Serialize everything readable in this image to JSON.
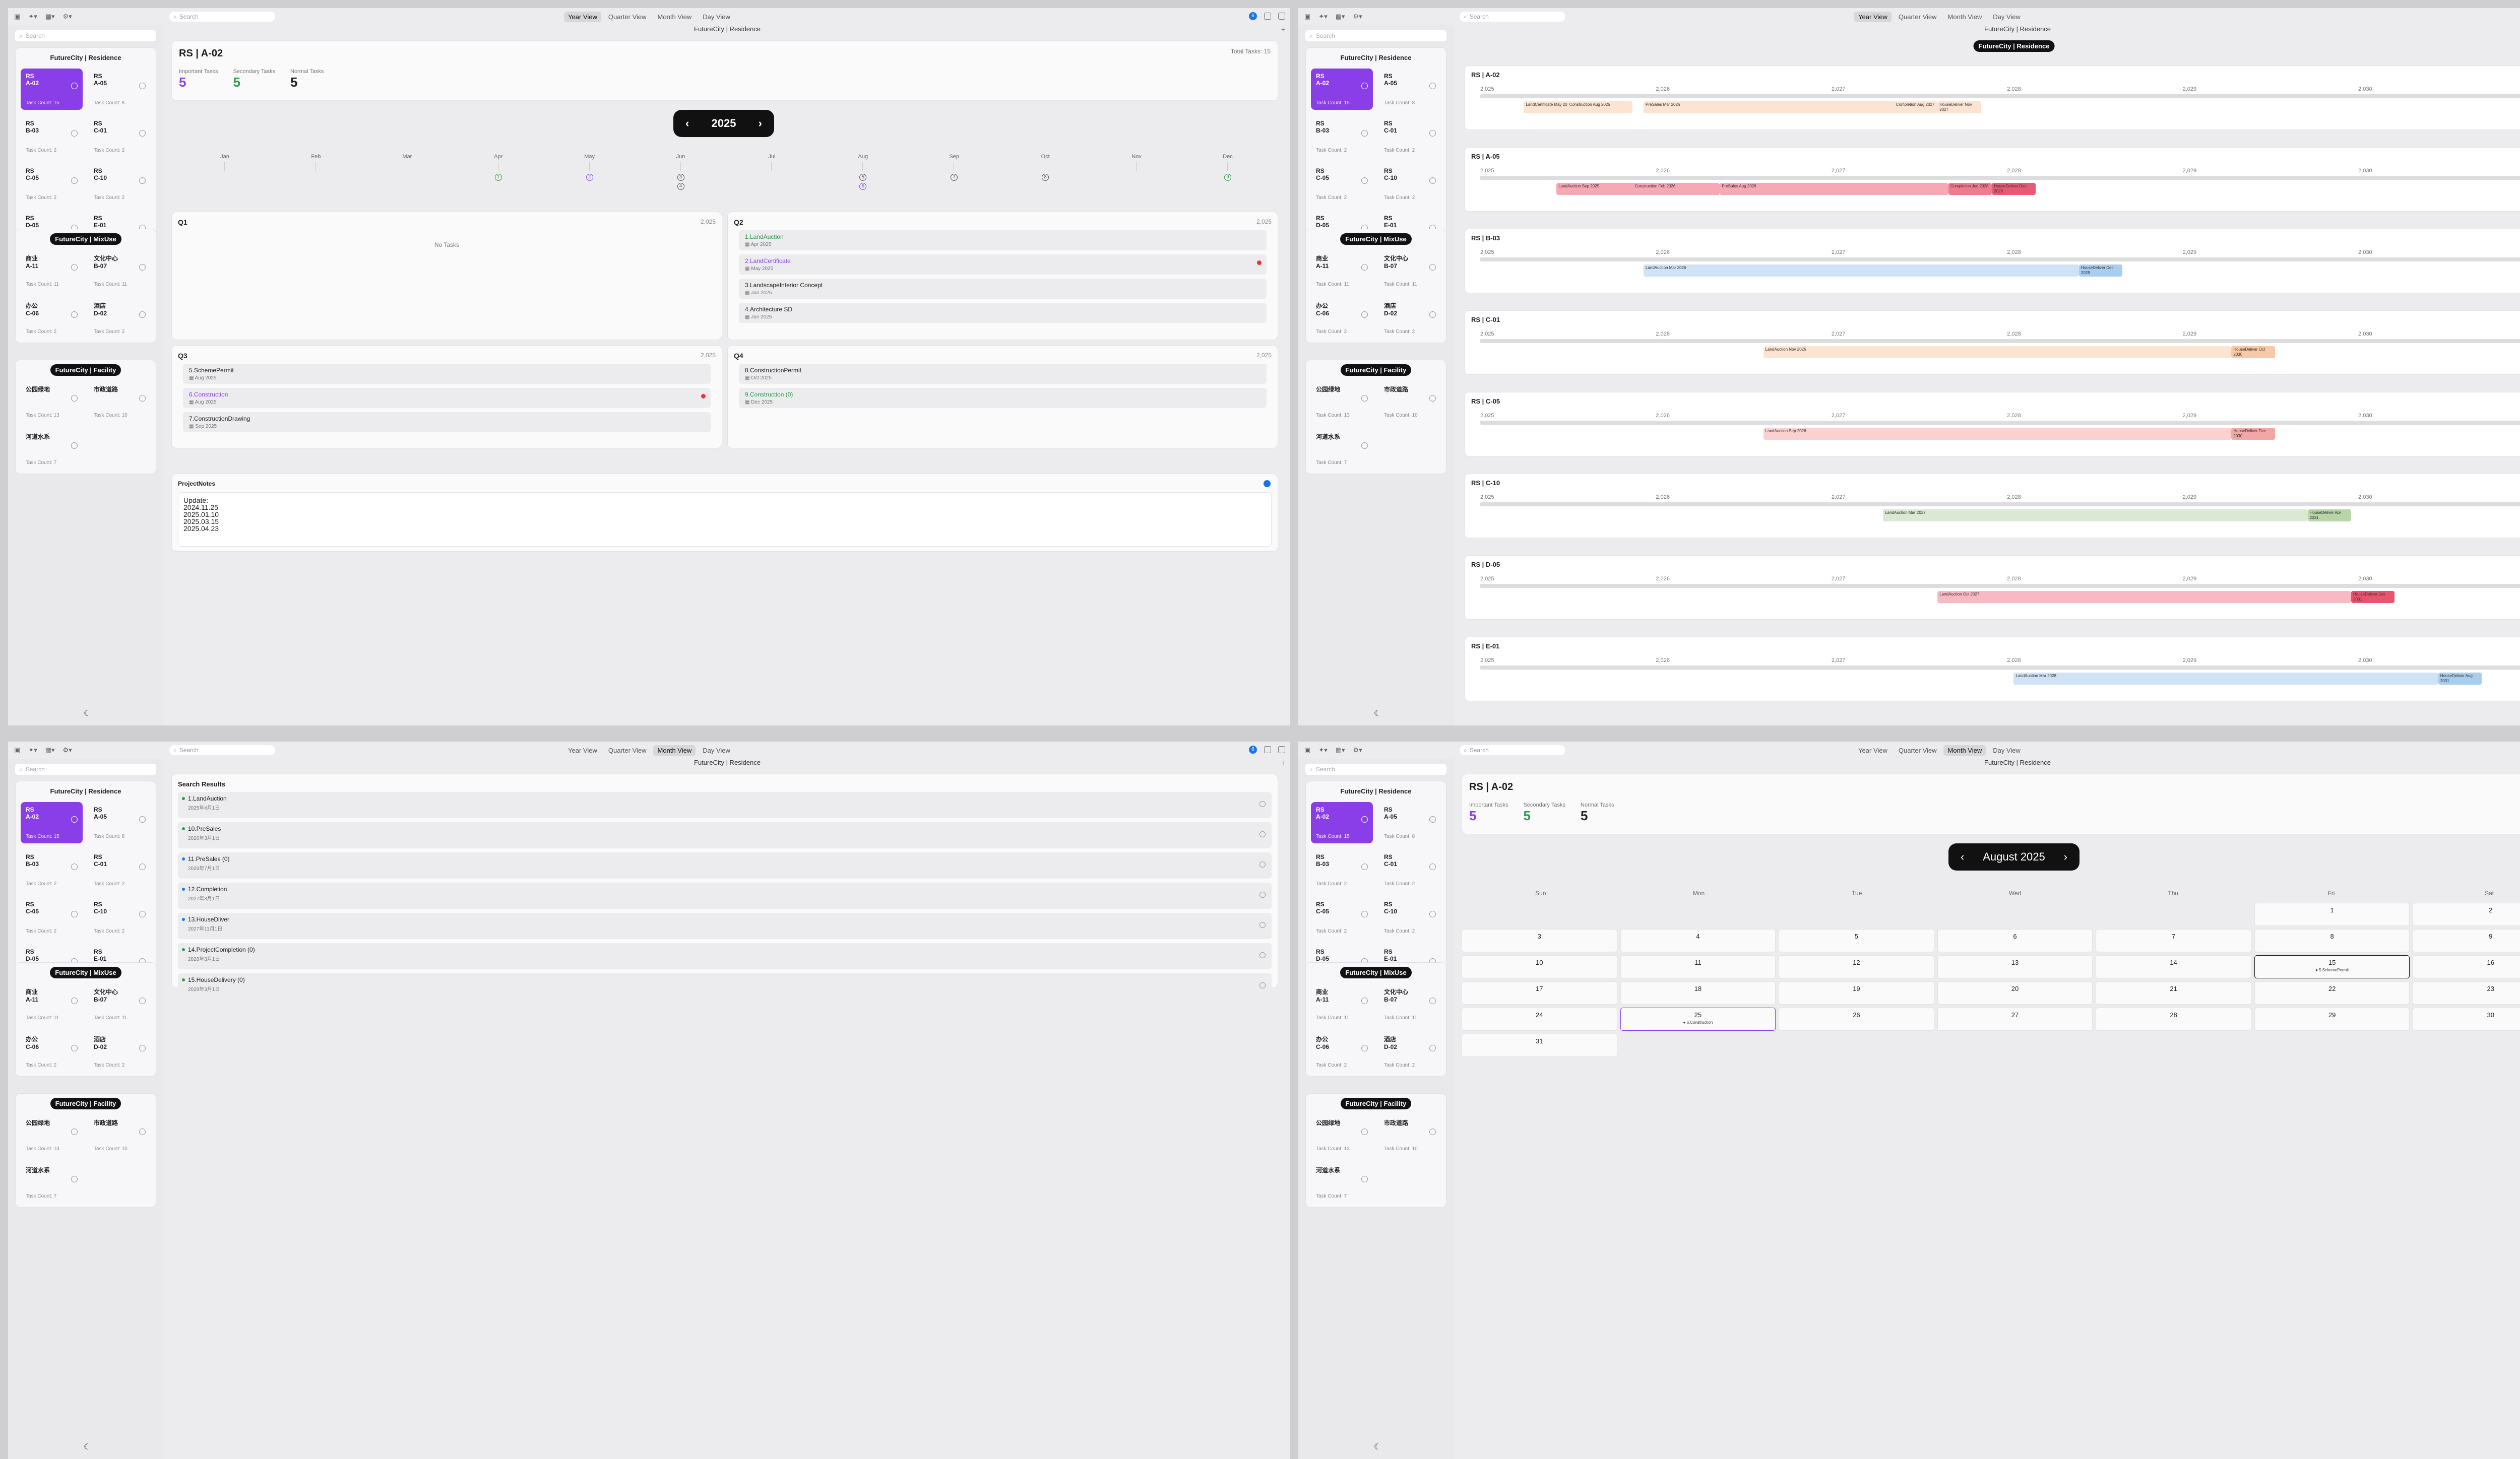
{
  "app": {
    "search_placeholder": "Search",
    "views": [
      "Year View",
      "Quarter View",
      "Month View",
      "Day View"
    ],
    "breadcrumb": "FutureCity | Residence",
    "badge": "6",
    "moon": "☾"
  },
  "sidebar": {
    "groups": [
      {
        "title": "FutureCity | Residence",
        "style": "light",
        "items": [
          [
            "RS",
            "A-02",
            "Task Count: 15"
          ],
          [
            "RS",
            "A-05",
            "Task Count: 8"
          ],
          [
            "RS",
            "B-03",
            "Task Count: 2"
          ],
          [
            "RS",
            "C-01",
            "Task Count: 2"
          ],
          [
            "RS",
            "C-05",
            "Task Count: 2"
          ],
          [
            "RS",
            "C-10",
            "Task Count: 2"
          ],
          [
            "RS",
            "D-05",
            "Task Count: 2"
          ],
          [
            "RS",
            "E-01",
            "Task Count: 2"
          ]
        ]
      },
      {
        "title": "FutureCity | MixUse",
        "style": "dark",
        "items": [
          [
            "商业",
            "A-11",
            "Task Count: 11"
          ],
          [
            "文化中心",
            "B-07",
            "Task Count: 11"
          ],
          [
            "办公",
            "C-06",
            "Task Count: 2"
          ],
          [
            "酒店",
            "D-02",
            "Task Count: 2"
          ]
        ]
      },
      {
        "title": "FutureCity | Facility",
        "style": "dark",
        "items": [
          [
            "公园绿地",
            "",
            "Task Count: 13"
          ],
          [
            "市政道路",
            "",
            "Task Count: 10"
          ],
          [
            "河道水系",
            "",
            "Task Count: 7"
          ]
        ]
      }
    ]
  },
  "project": {
    "title": "RS | A-02",
    "important_label": "Important Tasks",
    "important": "5",
    "secondary_label": "Secondary Tasks",
    "secondary": "5",
    "normal_label": "Normal Tasks",
    "normal": "5",
    "total": "Total Tasks: 15"
  },
  "year": {
    "label": "2025",
    "months": [
      "Jan",
      "Feb",
      "Mar",
      "Apr",
      "May",
      "Jun",
      "Jul",
      "Aug",
      "Sep",
      "Oct",
      "Nov",
      "Dec"
    ]
  },
  "quarters": [
    {
      "name": "Q1",
      "year": "2,025",
      "empty": "No Tasks",
      "tasks": []
    },
    {
      "name": "Q2",
      "year": "2,025",
      "tasks": [
        [
          "1.LandAuction",
          "Apr 2025",
          "#2a9a4a",
          false
        ],
        [
          "2.LandCertificate",
          "May 2025",
          "#8a3ee8",
          true
        ],
        [
          "3.LandscapeInterior Concept",
          "Jun 2025",
          "#222",
          false
        ],
        [
          "4.Architecture SD",
          "Jun 2025",
          "#222",
          false
        ]
      ]
    },
    {
      "name": "Q3",
      "year": "2,025",
      "tasks": [
        [
          "5.SchemePermit",
          "Aug 2025",
          "#222",
          false
        ],
        [
          "6.Construction",
          "Aug 2025",
          "#8a3ee8",
          true
        ],
        [
          "7.ConstructionDrawing",
          "Sep 2025",
          "#222",
          false
        ]
      ]
    },
    {
      "name": "Q4",
      "year": "2,025",
      "tasks": [
        [
          "8.ConstructionPermit",
          "Oct 2025",
          "#222",
          false
        ],
        [
          "9.Construction (0)",
          "Dec 2025",
          "#2a9a4a",
          false
        ]
      ]
    }
  ],
  "notes": {
    "title": "ProjectNotes",
    "text": "Update:\n2024.11.25\n2025.01.10\n2025.03.15\n2025.04.23"
  },
  "gantt": {
    "breadcrumb": "FutureCity | Residence",
    "years": [
      "2,025",
      "2,026",
      "2,027",
      "2,028",
      "2,029",
      "2,030",
      "2,031"
    ],
    "rows": [
      {
        "title": "RS | A-02",
        "bars": [
          [
            "LandCertificate",
            "May 2025",
            0.04,
            0.09,
            "#fde3d2"
          ],
          [
            "Construction",
            "Aug 2025",
            0.08,
            0.14,
            "#fde3d2"
          ],
          [
            "PreSales",
            "Mar 2026",
            0.15,
            0.42,
            "#fde3d2"
          ],
          [
            "Completion",
            "Aug 2027",
            0.38,
            0.42,
            "#fde3d2"
          ],
          [
            "HouseDeliver",
            "Nov 2027",
            0.42,
            0.46,
            "#fde3d2"
          ]
        ]
      },
      {
        "title": "RS | A-05",
        "bars": [
          [
            "LandAuction",
            "Sep 2025",
            0.07,
            0.15,
            "#f6a8b5"
          ],
          [
            "Construction",
            "Feb 2026",
            0.14,
            0.22,
            "#f6a8b5"
          ],
          [
            "PreSales",
            "Aug 2026",
            0.22,
            0.43,
            "#f6a8b5"
          ],
          [
            "Completion",
            "Jun 2028",
            0.43,
            0.47,
            "#f07a8e"
          ],
          [
            "HouseDeliver",
            "Dec 2028",
            0.47,
            0.51,
            "#e55a74"
          ]
        ]
      },
      {
        "title": "RS | B-03",
        "bars": [
          [
            "LandAuction",
            "Mar 2026",
            0.15,
            0.55,
            "#cfe2f6"
          ],
          [
            "HouseDeliver",
            "Dec 2029",
            0.55,
            0.59,
            "#a9cdef"
          ]
        ]
      },
      {
        "title": "RS | C-01",
        "bars": [
          [
            "LandAuction",
            "Nov 2026",
            0.26,
            0.69,
            "#fde3d2"
          ],
          [
            "HouseDeliver",
            "Oct 2030",
            0.69,
            0.73,
            "#f8c9a8"
          ]
        ]
      },
      {
        "title": "RS | C-05",
        "bars": [
          [
            "LandAuction",
            "Sep 2026",
            0.26,
            0.69,
            "#fad0d0"
          ],
          [
            "HouseDeliver",
            "Dec 2030",
            0.69,
            0.73,
            "#f3a6a6"
          ]
        ]
      },
      {
        "title": "RS | C-10",
        "bars": [
          [
            "LandAuction",
            "Mar 2027",
            0.37,
            0.76,
            "#dbe8d4"
          ],
          [
            "HouseDeliver",
            "Apr 2031",
            0.76,
            0.8,
            "#b9d4a8"
          ]
        ]
      },
      {
        "title": "RS | D-05",
        "bars": [
          [
            "LandAuction",
            "Oct 2027",
            0.42,
            0.8,
            "#f7b9c3"
          ],
          [
            "HouseDeliver",
            "Jan 2031",
            0.8,
            0.84,
            "#e8536e"
          ]
        ]
      },
      {
        "title": "RS | E-01",
        "bars": [
          [
            "LandAuction",
            "Mar 2028",
            0.49,
            0.88,
            "#cfe2f6"
          ],
          [
            "HouseDeliver",
            "Aug 2031",
            0.88,
            0.92,
            "#a9cdef"
          ]
        ]
      }
    ]
  },
  "search": {
    "title": "Search Results",
    "items": [
      [
        "1.LandAuction",
        "2025年4月1日",
        "#2a9a4a"
      ],
      [
        "10.PreSales",
        "2026年3月1日",
        "#2a9a4a"
      ],
      [
        "11.PreSales (0)",
        "2026年7月1日",
        "#1a73e8"
      ],
      [
        "12.Completion",
        "2027年8月1日",
        "#1a73e8"
      ],
      [
        "13.HouseDliver",
        "2027年11月1日",
        "#1a73e8"
      ],
      [
        "14.ProjectCompletion (0)",
        "2028年3月1日",
        "#2a9a4a"
      ],
      [
        "15.HouseDelivery (0)",
        "2028年3月1日",
        "#2a9a4a"
      ]
    ]
  },
  "month": {
    "label": "August 2025",
    "days": [
      "Sun",
      "Mon",
      "Tue",
      "Wed",
      "Thu",
      "Fri",
      "Sat"
    ],
    "ev15": "● 5.SchemePermit",
    "ev25": "● 6.Construction"
  }
}
